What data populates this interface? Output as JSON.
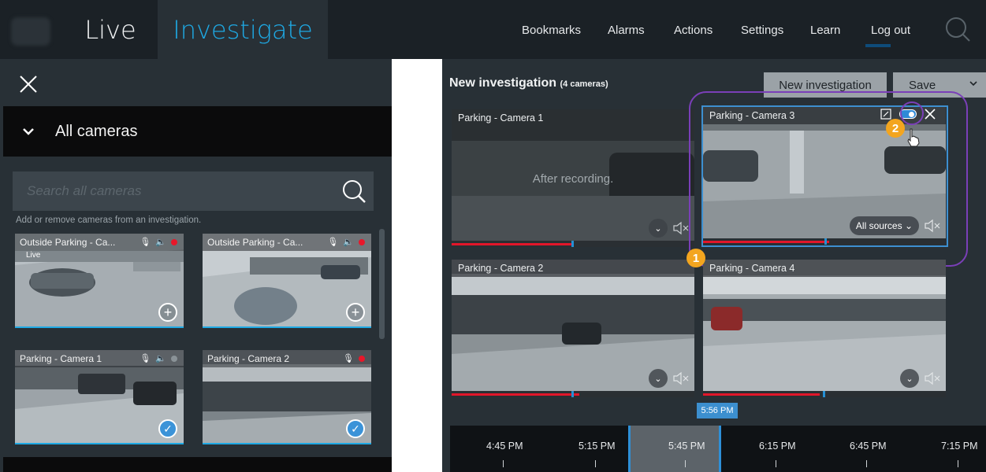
{
  "nav": {
    "tabs": [
      {
        "label": "Live",
        "active": false
      },
      {
        "label": "Investigate",
        "active": true
      }
    ],
    "links": [
      "Bookmarks",
      "Alarms",
      "Actions",
      "Settings",
      "Learn",
      "Log out"
    ],
    "search_icon": "search-icon",
    "accent_color": "#1ea9e4"
  },
  "left": {
    "section_label": "All cameras",
    "search": {
      "placeholder": "Search all cameras",
      "value": ""
    },
    "hint": "Add or remove cameras from an investigation.",
    "thumbnails": [
      {
        "title": "Outside Parking - Ca...",
        "live_label": "Live",
        "action": "add"
      },
      {
        "title": "Outside Parking - Ca...",
        "live_label": "",
        "action": "add"
      },
      {
        "title": "Parking - Camera 1",
        "live_label": "",
        "action": "selected"
      },
      {
        "title": "Parking - Camera 2",
        "live_label": "",
        "action": "selected"
      }
    ]
  },
  "investigation": {
    "title": "New investigation",
    "camera_count": "(4 cameras)",
    "new_button": "New investigation",
    "save_button": "Save",
    "cameras": [
      {
        "title": "Parking - Camera 1",
        "overlay_text": "After recording."
      },
      {
        "title": "Parking - Camera 3",
        "sources_label": "All sources"
      },
      {
        "title": "Parking - Camera 2"
      },
      {
        "title": "Parking - Camera 4"
      }
    ],
    "callouts": [
      "1",
      "2"
    ]
  },
  "timeline": {
    "current_time": "5:56 PM",
    "labels": [
      "4:45 PM",
      "5:15 PM",
      "5:45 PM",
      "6:15 PM",
      "6:45 PM",
      "7:15 PM"
    ]
  },
  "colors": {
    "recording_red": "#e2162a",
    "highlight_purple": "#7a3fb8",
    "callout_orange": "#f3a51f"
  }
}
